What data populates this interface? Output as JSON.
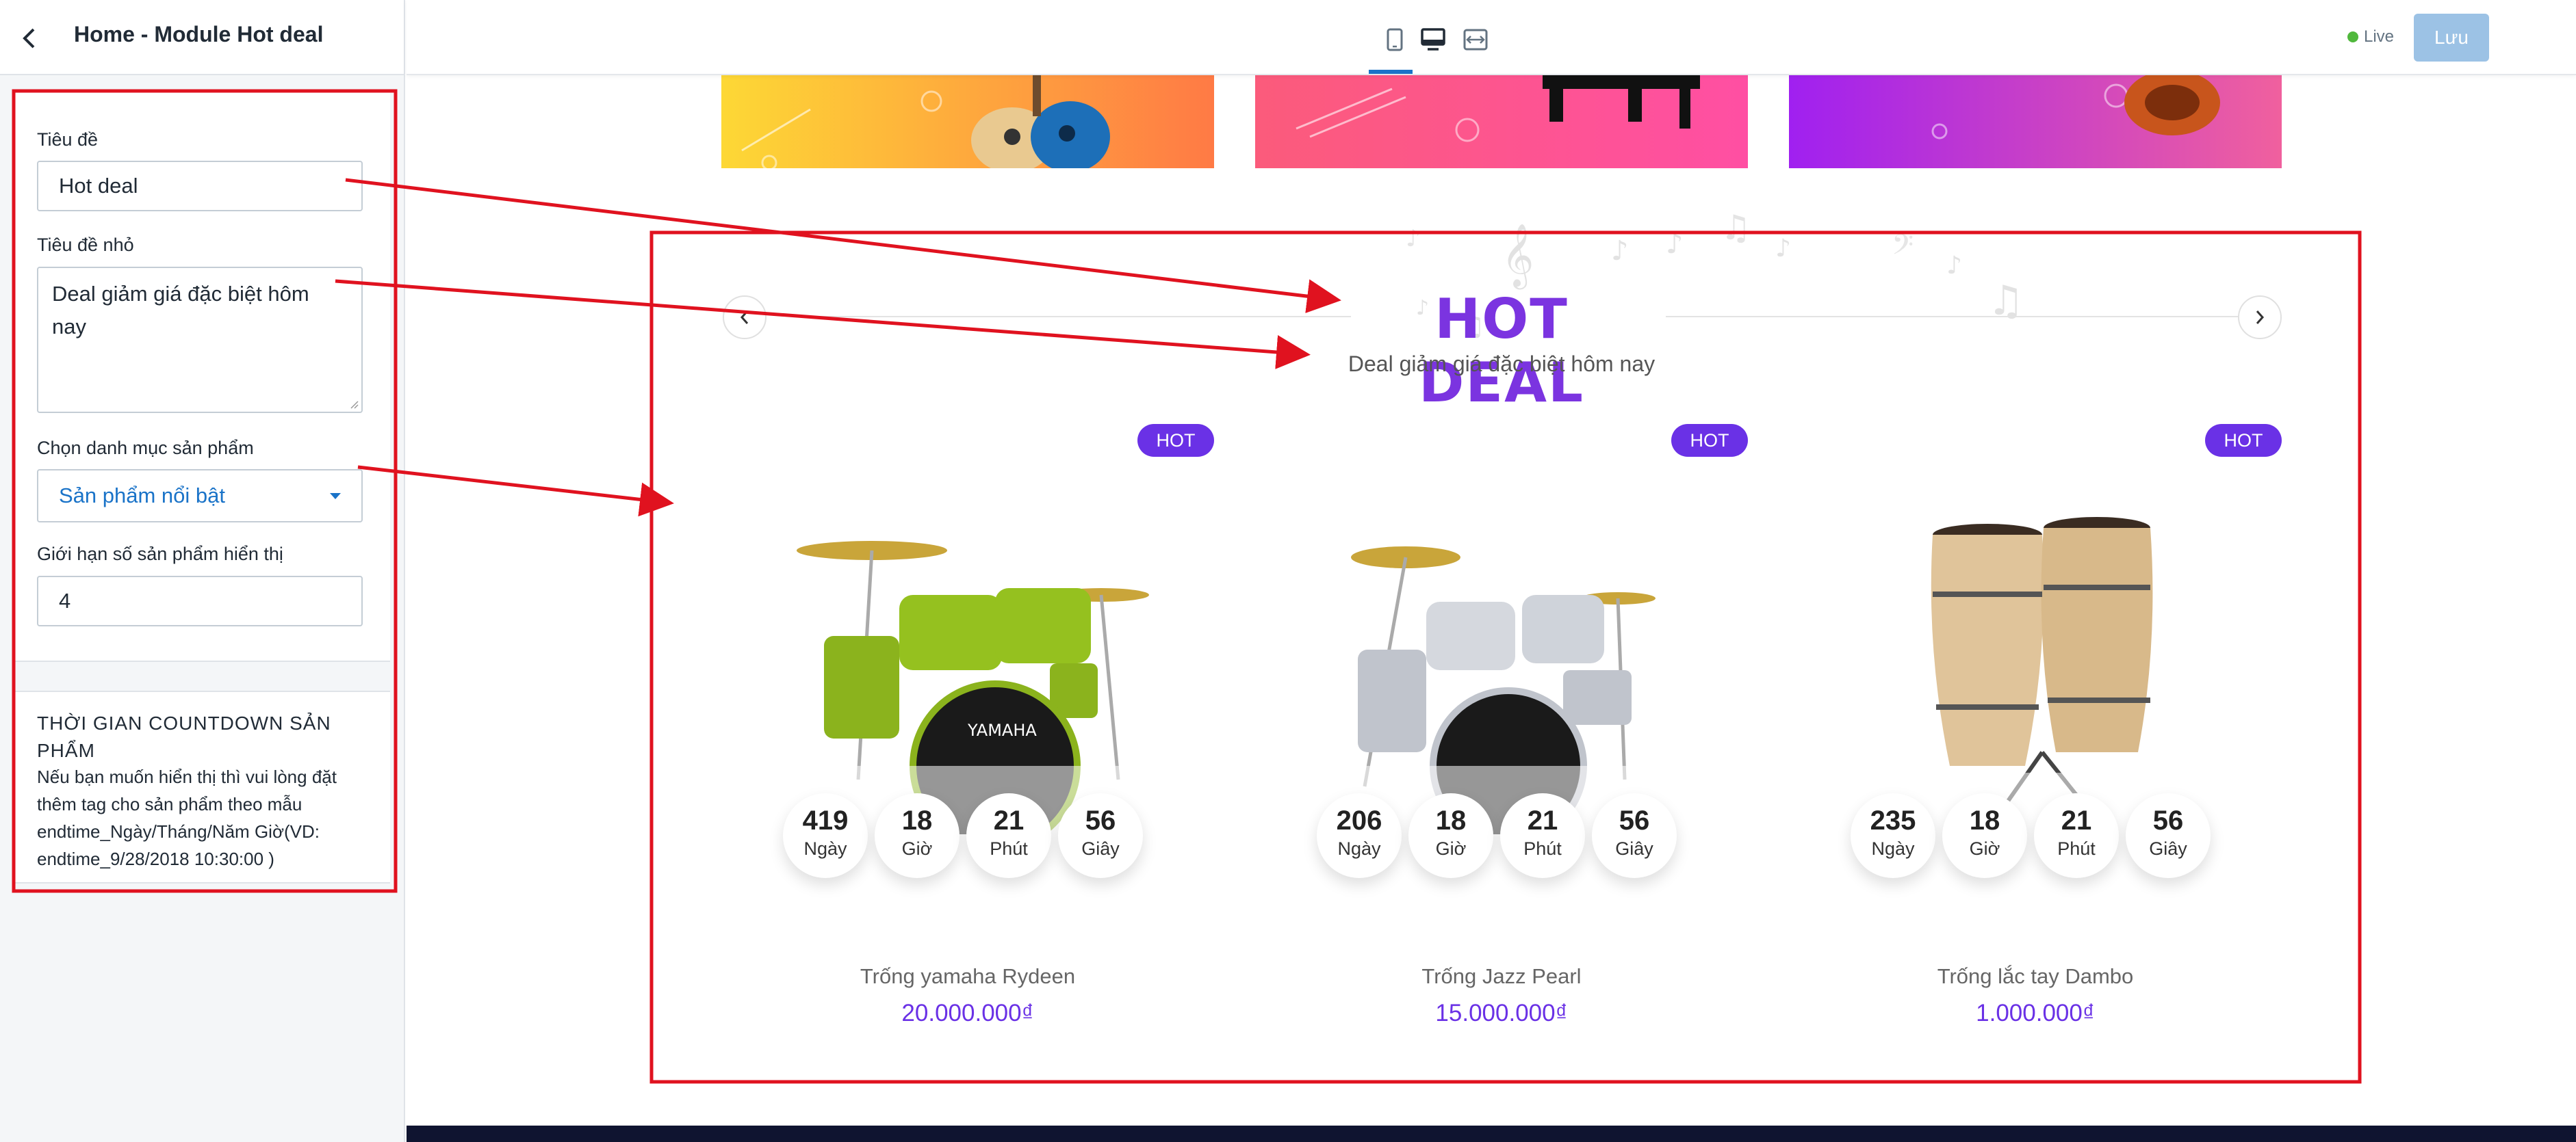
{
  "sidebar": {
    "title": "Home - Module Hot deal",
    "fields": {
      "title_label": "Tiêu đề",
      "title_value": "Hot deal",
      "subtitle_label": "Tiêu đề nhỏ",
      "subtitle_value": "Deal giảm giá đặc biệt hôm nay",
      "category_label": "Chọn danh mục sản phẩm",
      "category_value": "Sản phẩm nổi bật",
      "limit_label": "Giới hạn số sản phẩm hiển thị",
      "limit_value": "4"
    },
    "countdown": {
      "heading": "THỜI GIAN COUNTDOWN SẢN PHẨM",
      "description": "Nếu bạn muốn hiển thị thì vui lòng đặt thêm tag cho sản phẩm theo mẫu endtime_Ngày/Tháng/Năm Giờ(VD: endtime_9/28/2018 10:30:00 )"
    }
  },
  "toolbar": {
    "live_label": "Live",
    "save_label": "Lưu",
    "views": [
      "mobile-icon",
      "desktop-icon",
      "fullwidth-icon"
    ],
    "active_view": "desktop"
  },
  "hot_deal": {
    "title": "HOT DEAL",
    "subtitle": "Deal giảm giá đặc biệt hôm nay",
    "badge": "HOT",
    "units": {
      "days": "Ngày",
      "hours": "Giờ",
      "minutes": "Phút",
      "seconds": "Giây"
    },
    "products": [
      {
        "name": "Trống yamaha Rydeen",
        "price": "20.000.000₫",
        "days": "419",
        "hours": "18",
        "minutes": "21",
        "seconds": "56",
        "image": "green-drum-kit"
      },
      {
        "name": "Trống Jazz Pearl",
        "price": "15.000.000₫",
        "days": "206",
        "hours": "18",
        "minutes": "21",
        "seconds": "56",
        "image": "silver-drum-kit"
      },
      {
        "name": "Trống lắc tay Dambo",
        "price": "1.000.000₫",
        "days": "235",
        "hours": "18",
        "minutes": "21",
        "seconds": "56",
        "image": "conga-drums"
      }
    ]
  },
  "colors": {
    "accent": "#6a31e6",
    "title": "#7b34e0",
    "annotation": "#e0121f",
    "link": "#1a73c8",
    "save_disabled": "#9cc2e5"
  }
}
